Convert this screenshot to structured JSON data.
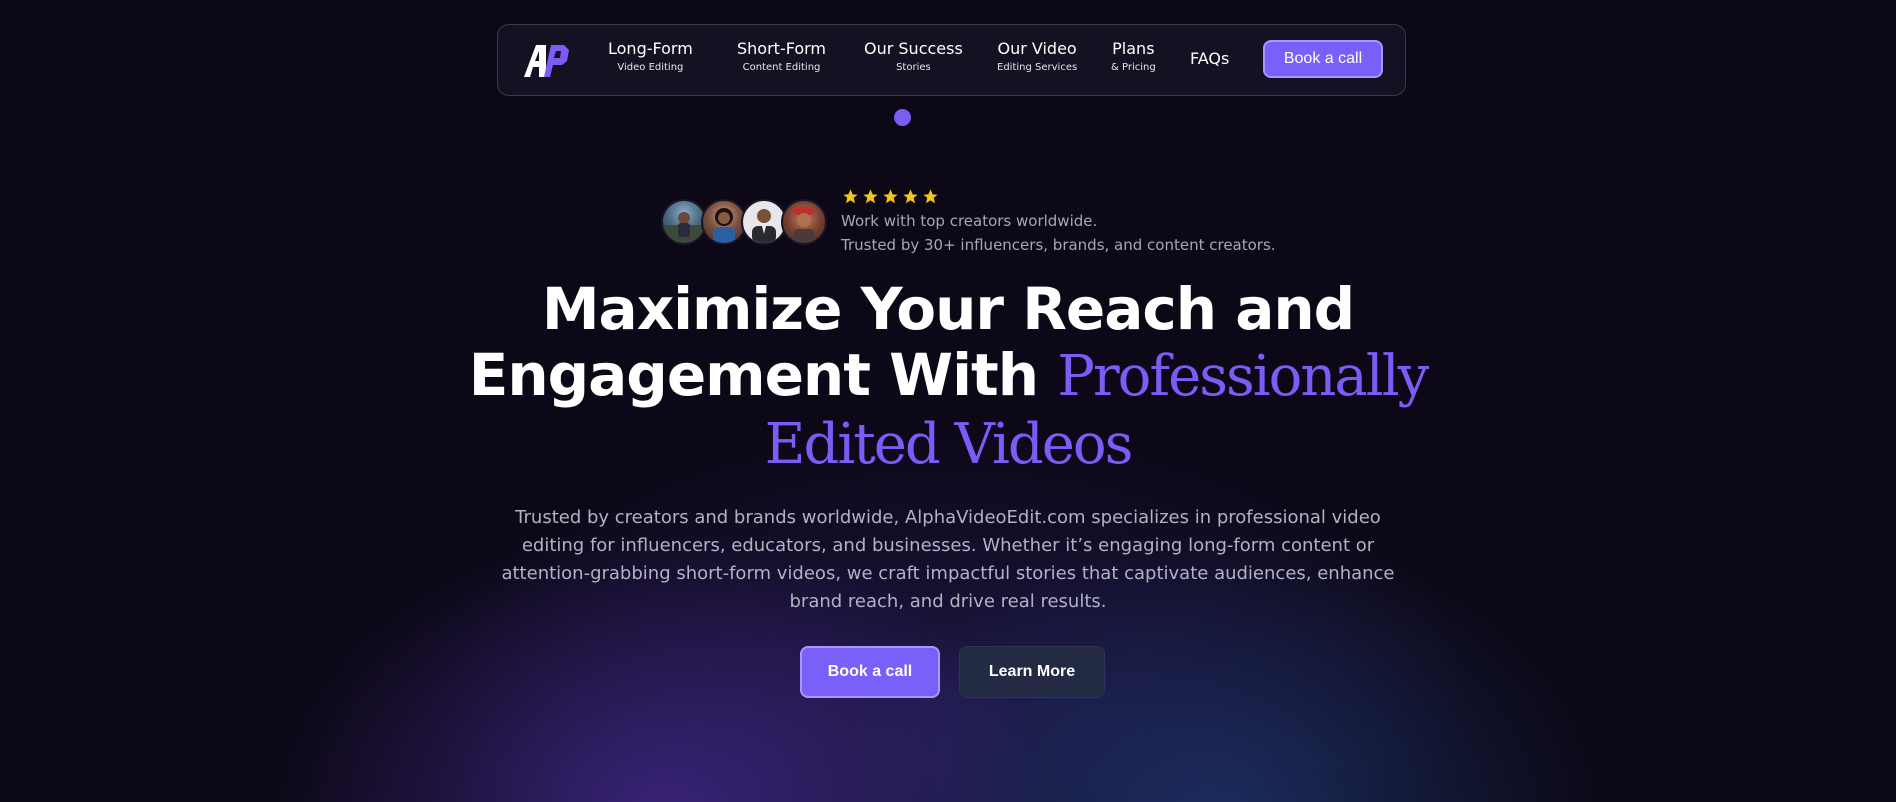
{
  "nav": {
    "logo_text": "AP",
    "items": [
      {
        "label": "Long-Form",
        "sub": "Video Editing"
      },
      {
        "label": "Short-Form",
        "sub": "Content Editing"
      },
      {
        "label": "Our Success",
        "sub": "Stories"
      },
      {
        "label": "Our Video",
        "sub": "Editing Services"
      },
      {
        "label": "Plans",
        "sub": "& Pricing"
      }
    ],
    "faq_label": "FAQs",
    "cta_label": "Book a call"
  },
  "social_proof": {
    "rating_stars": 5,
    "line1": "Work with top creators worldwide.",
    "line2": "Trusted by 30+ influencers, brands, and content creators."
  },
  "hero": {
    "title_line1": "Maximize Your Reach and",
    "title_line2_plain": "Engagement With ",
    "title_line2_accent": "Professionally",
    "title_line3_accent": "Edited Videos",
    "description": "Trusted by creators and brands worldwide, AlphaVideoEdit.com specializes in professional video editing for influencers, educators, and businesses. Whether it’s engaging long-form content or attention-grabbing short-form videos, we craft impactful stories that captivate audiences, enhance brand reach, and drive real results.",
    "primary_button": "Book a call",
    "secondary_button": "Learn More"
  },
  "colors": {
    "background": "#0c0817",
    "accent": "#7b5cf6",
    "star": "#f5c518",
    "secondary_button": "#222a44"
  }
}
